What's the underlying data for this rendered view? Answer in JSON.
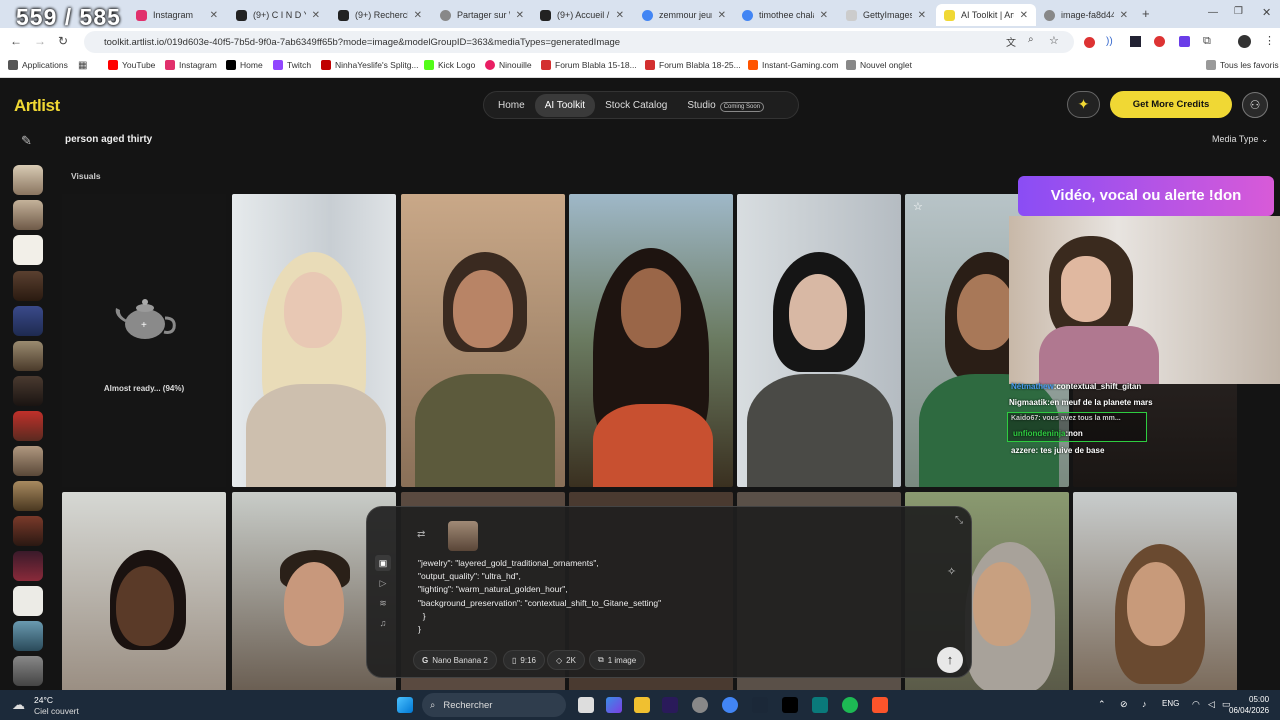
{
  "browser": {
    "tabs": [
      {
        "label": "Instagram",
        "color": "#e1306c"
      },
      {
        "label": "(9+) C I N D Y",
        "color": "#222222"
      },
      {
        "label": "(9+) Recherche",
        "color": "#222222"
      },
      {
        "label": "Partager sur W",
        "color": "#888888"
      },
      {
        "label": "(9+) Accueil / ",
        "color": "#222222"
      },
      {
        "label": "zemmour jeun",
        "color": "#4285f4"
      },
      {
        "label": "timothee chala",
        "color": "#4285f4"
      },
      {
        "label": "GettyImages-2",
        "color": "#cccccc"
      },
      {
        "label": "AI Toolkit | Art",
        "color": "#f0d834"
      },
      {
        "label": "image-fa8d44",
        "color": "#888888"
      }
    ],
    "url": "toolkit.artlist.io/019d603e-40f5-7b5d-9f0a-7ab6349ff65b?mode=image&modelGroupID=363&mediaTypes=generatedImage",
    "bookmarks": [
      {
        "label": "Applications",
        "color": "#555555"
      },
      {
        "label": "YouTube",
        "color": "#ff0000"
      },
      {
        "label": "Instagram",
        "color": "#e1306c"
      },
      {
        "label": "Home",
        "color": "#000000"
      },
      {
        "label": "Twitch",
        "color": "#9146ff"
      },
      {
        "label": "NinhaYeslife's Splitg...",
        "color": "#c00000"
      },
      {
        "label": "Kick Logo",
        "color": "#53fc18"
      },
      {
        "label": "Ninouille",
        "color": "#e91e63"
      },
      {
        "label": "Forum Blabla 15-18...",
        "color": "#d32f2f"
      },
      {
        "label": "Forum Blabla 18-25...",
        "color": "#d32f2f"
      },
      {
        "label": "Instant-Gaming.com",
        "color": "#ff5400"
      },
      {
        "label": "Nouvel onglet",
        "color": "#888888"
      }
    ],
    "all_bookmarks": "Tous les favoris"
  },
  "app": {
    "logo": "Artlist",
    "nav": [
      {
        "label": "Home"
      },
      {
        "label": "AI Toolkit",
        "active": true
      },
      {
        "label": "Stock Catalog"
      },
      {
        "label": "Studio"
      }
    ],
    "coming_soon": "Coming Soon",
    "credits_button": "Get More Credits",
    "prompt_title": "person aged thirty",
    "media_type": "Media Type",
    "section": "Visuals",
    "loading_text": "Almost ready... (94%)",
    "accent": "#f0d834"
  },
  "prompt_panel": {
    "json_lines": [
      "\"jewelry\": \"layered_gold_traditional_ornaments\",",
      "\"output_quality\": \"ultra_hd\",",
      "\"lighting\": \"warm_natural_golden_hour\",",
      "\"background_preservation\": \"contextual_shift_to_Gitane_setting\"",
      "  }",
      "}"
    ],
    "model": "Nano Banana 2",
    "ratio": "9:16",
    "resolution": "2K",
    "count": "1 image"
  },
  "overlay": {
    "counter": "559 / 585",
    "donation": "Vidéo, vocal ou alerte !don",
    "chat": [
      {
        "user": "Nétmathew",
        "text": ":contextual_shift_gitan"
      },
      {
        "user": "Nigmaatik",
        "text": ":en meuf de la planete mars"
      },
      {
        "user": "Kaido67",
        "text": ": vous avez tous la mm..."
      },
      {
        "user": "unfiondeninja",
        "text": ":non"
      },
      {
        "user": "azzere",
        "text": ": tes juive de base"
      }
    ]
  },
  "taskbar": {
    "temperature": "24°C",
    "weather": "Ciel couvert",
    "search": "Rechercher",
    "language": "ENG",
    "time": "05:00",
    "date": "06/04/2026"
  }
}
